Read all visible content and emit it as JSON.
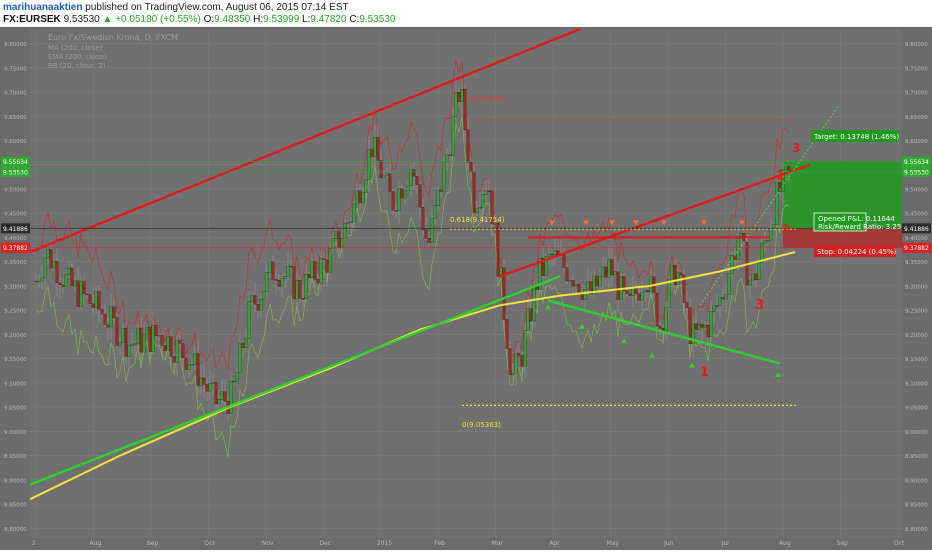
{
  "header": {
    "author": "marihuanaaktien",
    "published": "published on TradingView.com, August 06, 2015 07:14 EST",
    "symbol": "FX:EURSEK",
    "price": "9.53530",
    "change": "+0.05180 (+0.55%)",
    "open_label": "O:",
    "open": "9.48350",
    "high_label": "H:",
    "high": "9.53999",
    "low_label": "L:",
    "low": "9.47820",
    "close_label": "C:",
    "close": "9.53530"
  },
  "chart_data": {
    "type": "candlestick",
    "title": "Euro Fx/Swedish Krona, D, FXCM",
    "legend": [
      "MA (200, close)",
      "EMA (200, close)",
      "BB (20, close, 2)"
    ],
    "x_ticks": [
      "2",
      "Aug",
      "Sep",
      "Oct",
      "Nov",
      "Dec",
      "2015",
      "Feb",
      "Mar",
      "Apr",
      "May",
      "Jun",
      "Jul",
      "Aug",
      "Sep",
      "Oct"
    ],
    "y_ticks": [
      "9.80000",
      "9.75000",
      "9.70000",
      "9.65000",
      "9.60000",
      "9.55000",
      "9.50000",
      "9.45000",
      "9.40000",
      "9.35000",
      "9.30000",
      "9.25000",
      "9.20000",
      "9.15000",
      "9.10000",
      "9.05000",
      "9.00000",
      "8.95000",
      "8.90000",
      "8.85000",
      "8.80000"
    ],
    "ylim": [
      8.78,
      9.83
    ],
    "price_tags": [
      {
        "value": 9.55634,
        "label": "9.55634",
        "side": "both",
        "color": "#2ea82e"
      },
      {
        "value": 9.5353,
        "label": "9.53530",
        "side": "both",
        "color": "#2ea82e"
      },
      {
        "value": 9.41886,
        "label": "9.41886",
        "side": "both",
        "color": "#2b2b2b"
      },
      {
        "value": 9.37882,
        "label": "9.37882",
        "side": "both",
        "color": "#e02020"
      }
    ],
    "fib_levels": [
      {
        "label": "0.618(9.41754)",
        "value": 9.41754,
        "color": "#f2e23a"
      },
      {
        "label": "0(9.05363)",
        "value": 9.05363,
        "color": "#f2e23a"
      },
      {
        "label": "1(9.64246)",
        "value": 9.64246,
        "color": "#e23a3a"
      }
    ],
    "position_labels": {
      "target": "Target: 0.13748 (1.46%)",
      "opened": "Opened P&L: 0.11644",
      "risk_reward": "Risk/Reward Ratio: 3.25",
      "stop": "Stop: 0.04224 (0.45%)"
    },
    "wave_labels": [
      "1",
      "2",
      "3"
    ],
    "colors": {
      "up": "#27b527",
      "down": "#b3261e",
      "ma": "#f2e23a",
      "trend_red": "#e01b1b",
      "trend_green": "#2ed12e",
      "background": "#6b6b6b"
    }
  }
}
